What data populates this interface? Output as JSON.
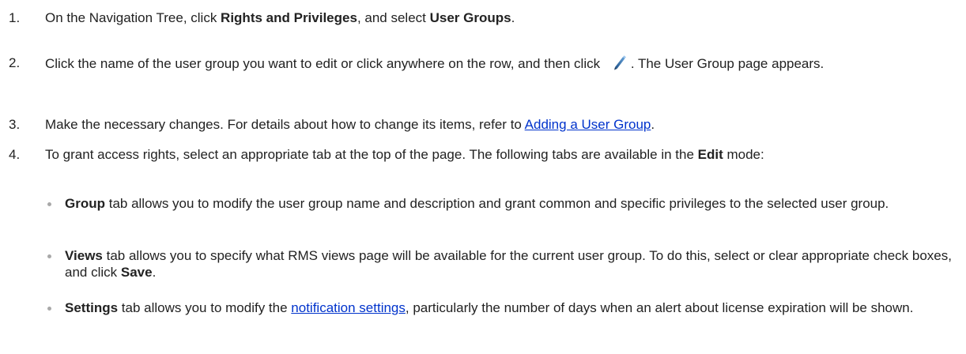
{
  "steps": [
    {
      "num": "1.",
      "text_1": "On the Navigation Tree, click ",
      "bold_1": "Rights and Privileges",
      "text_2": ", and select ",
      "bold_2": "User Groups",
      "text_3": "."
    },
    {
      "num": "2.",
      "text_1": "Click the name of the user group you want to edit or click anywhere on the row, and then click ",
      "text_2": ". The User Group page appears.",
      "icon": "pencil-edit-icon"
    },
    {
      "num": "3.",
      "text_1": "Make the necessary changes. For details about how to change its items, refer to ",
      "link": "Adding a User Group",
      "text_2": "."
    },
    {
      "num": "4.",
      "text_1": "To grant access rights, select an appropriate tab at the top of the page. The following tabs are available in the ",
      "bold_1": "Edit",
      "text_2": " mode:"
    }
  ],
  "tabs": [
    {
      "bold": "Group",
      "text": " tab allows you to modify the user group name and description and grant common and specific privileges to the selected user group."
    },
    {
      "bold": "Views",
      "text_1": " tab allows you to specify what RMS views page will be available for the current user group. To do this, select or clear appropriate check boxes, and click ",
      "bold_2": "Save",
      "text_2": "."
    },
    {
      "bold": "Settings",
      "text_1": " tab allows you to modify the ",
      "link": "notification settings",
      "text_2": ", particularly the number of days when an alert about license expiration will be shown."
    }
  ],
  "colors": {
    "text": "#222222",
    "link": "#0033cc",
    "bullet": "#a9a9a9"
  }
}
